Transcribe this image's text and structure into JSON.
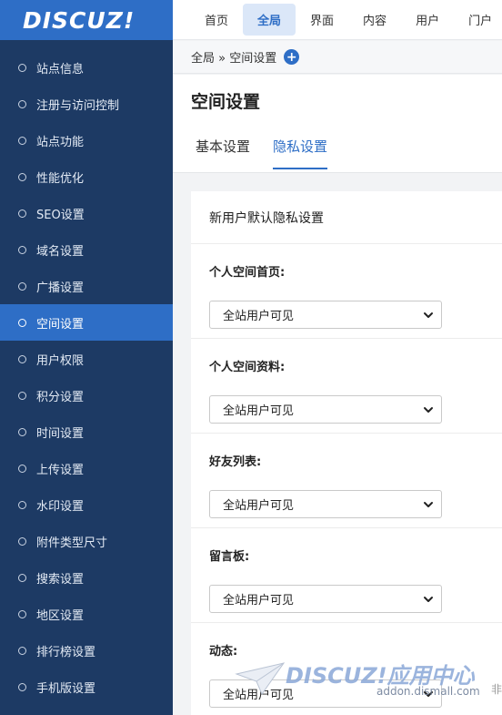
{
  "logo": "DISCUZ!",
  "sidebar": {
    "items": [
      {
        "label": "站点信息"
      },
      {
        "label": "注册与访问控制"
      },
      {
        "label": "站点功能"
      },
      {
        "label": "性能优化"
      },
      {
        "label": "SEO设置"
      },
      {
        "label": "域名设置"
      },
      {
        "label": "广播设置"
      },
      {
        "label": "空间设置"
      },
      {
        "label": "用户权限"
      },
      {
        "label": "积分设置"
      },
      {
        "label": "时间设置"
      },
      {
        "label": "上传设置"
      },
      {
        "label": "水印设置"
      },
      {
        "label": "附件类型尺寸"
      },
      {
        "label": "搜索设置"
      },
      {
        "label": "地区设置"
      },
      {
        "label": "排行榜设置"
      },
      {
        "label": "手机版设置"
      }
    ],
    "active_index": 7
  },
  "topnav": {
    "items": [
      {
        "label": "首页"
      },
      {
        "label": "全局"
      },
      {
        "label": "界面"
      },
      {
        "label": "内容"
      },
      {
        "label": "用户"
      },
      {
        "label": "门户"
      }
    ],
    "active_index": 1
  },
  "breadcrumb": {
    "text": "全局 » 空间设置",
    "add_icon": "plus-circle-icon"
  },
  "header": {
    "title": "空间设置",
    "tabs": [
      {
        "label": "基本设置"
      },
      {
        "label": "隐私设置"
      }
    ],
    "active_tab": 1
  },
  "panel": {
    "title": "新用户默认隐私设置",
    "fields": [
      {
        "label": "个人空间首页:",
        "value": "全站用户可见"
      },
      {
        "label": "个人空间资料:",
        "value": "全站用户可见"
      },
      {
        "label": "好友列表:",
        "value": "全站用户可见"
      },
      {
        "label": "留言板:",
        "value": "全站用户可见"
      },
      {
        "label": "动态:",
        "value": "全站用户可见"
      }
    ]
  },
  "watermark": {
    "logo": "DISCUZ!应用中心",
    "url": "addon.dismall.com",
    "trailing": "非"
  },
  "colors": {
    "sidebar_bg": "#1d3a64",
    "accent": "#2e6ec6"
  }
}
